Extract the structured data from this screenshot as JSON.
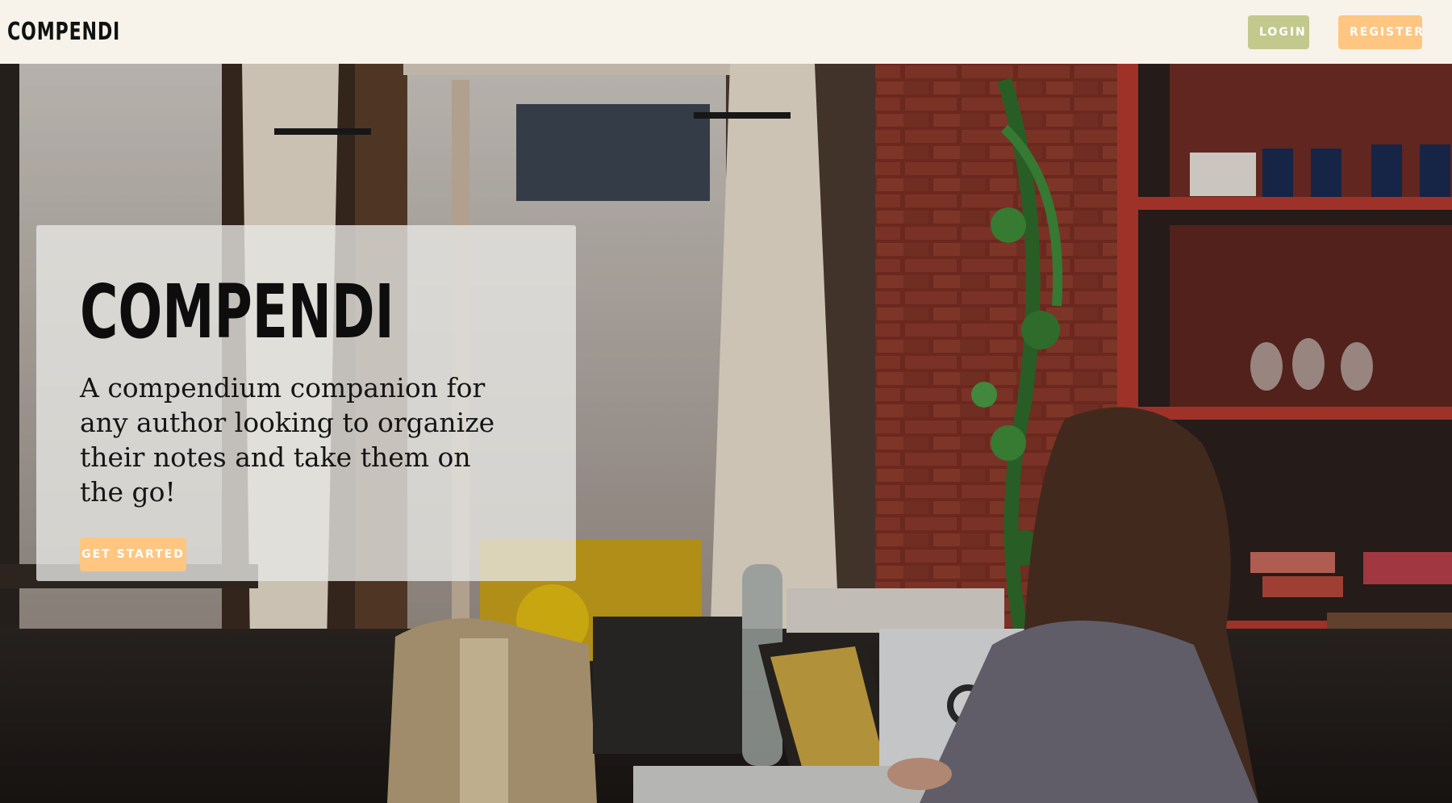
{
  "header": {
    "brand": "COMPENDI",
    "login_label": "LOGIN",
    "register_label": "REGISTER"
  },
  "hero": {
    "title": "COMPENDI",
    "subtitle": "A compendium companion for any author looking to organize their notes and take them on the go!",
    "cta_label": "GET STARTED"
  },
  "colors": {
    "page_bg": "#f7f3ea",
    "login_button": "#c3c98d",
    "register_button": "#fec681",
    "cta_button": "#fec681"
  }
}
